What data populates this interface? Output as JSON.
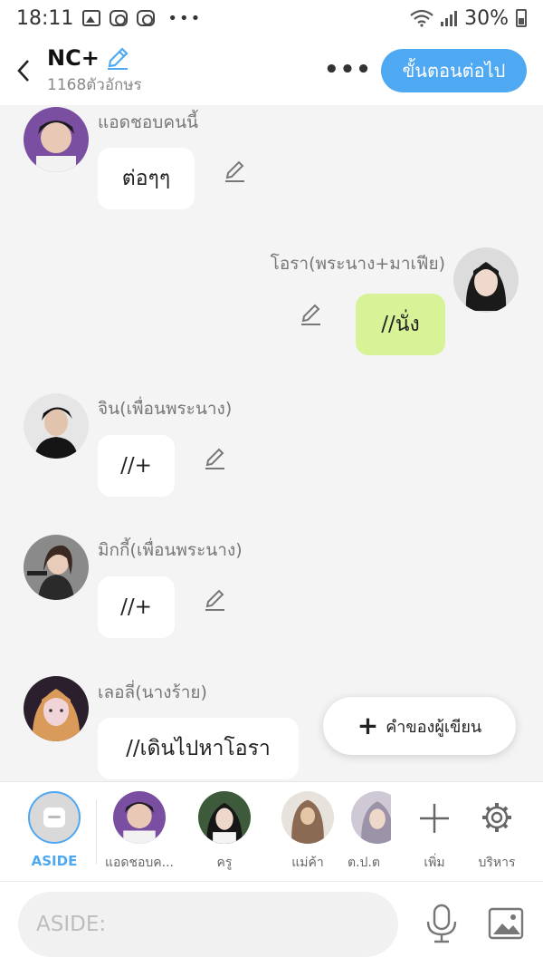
{
  "status": {
    "time": "18:11",
    "battery": "30%"
  },
  "header": {
    "title": "NC+",
    "subtitle": "1168ตัวอักษร",
    "next_label": "ขั้นตอนต่อไป"
  },
  "messages": [
    {
      "name": "แอดชอบคนนี้",
      "text": "ต่อๆๆ"
    },
    {
      "name": "โอรา(พระนาง+มาเฟีย)",
      "text": "//นั่ง"
    },
    {
      "name": "จิน(เพื่อนพระนาง)",
      "text": "//+"
    },
    {
      "name": "มิกกี้(เพื่อนพระนาง)",
      "text": "//+"
    },
    {
      "name": "เลอลี่(นางร้าย)",
      "text": "//เดินไปหาโอรา"
    }
  ],
  "fab": {
    "label": "คำของผู้เขียน"
  },
  "characters": [
    {
      "label": "ASIDE"
    },
    {
      "label": "แอดชอบค..."
    },
    {
      "label": "ครู"
    },
    {
      "label": "แม่ค้า"
    },
    {
      "label": "ต.ป.ต"
    }
  ],
  "tools": {
    "add_label": "เพิ่ม",
    "manage_label": "บริหาร"
  },
  "input": {
    "placeholder": "ASIDE:"
  },
  "colors": {
    "accent": "#4fa8f2",
    "mine_bubble": "#d7f297"
  }
}
